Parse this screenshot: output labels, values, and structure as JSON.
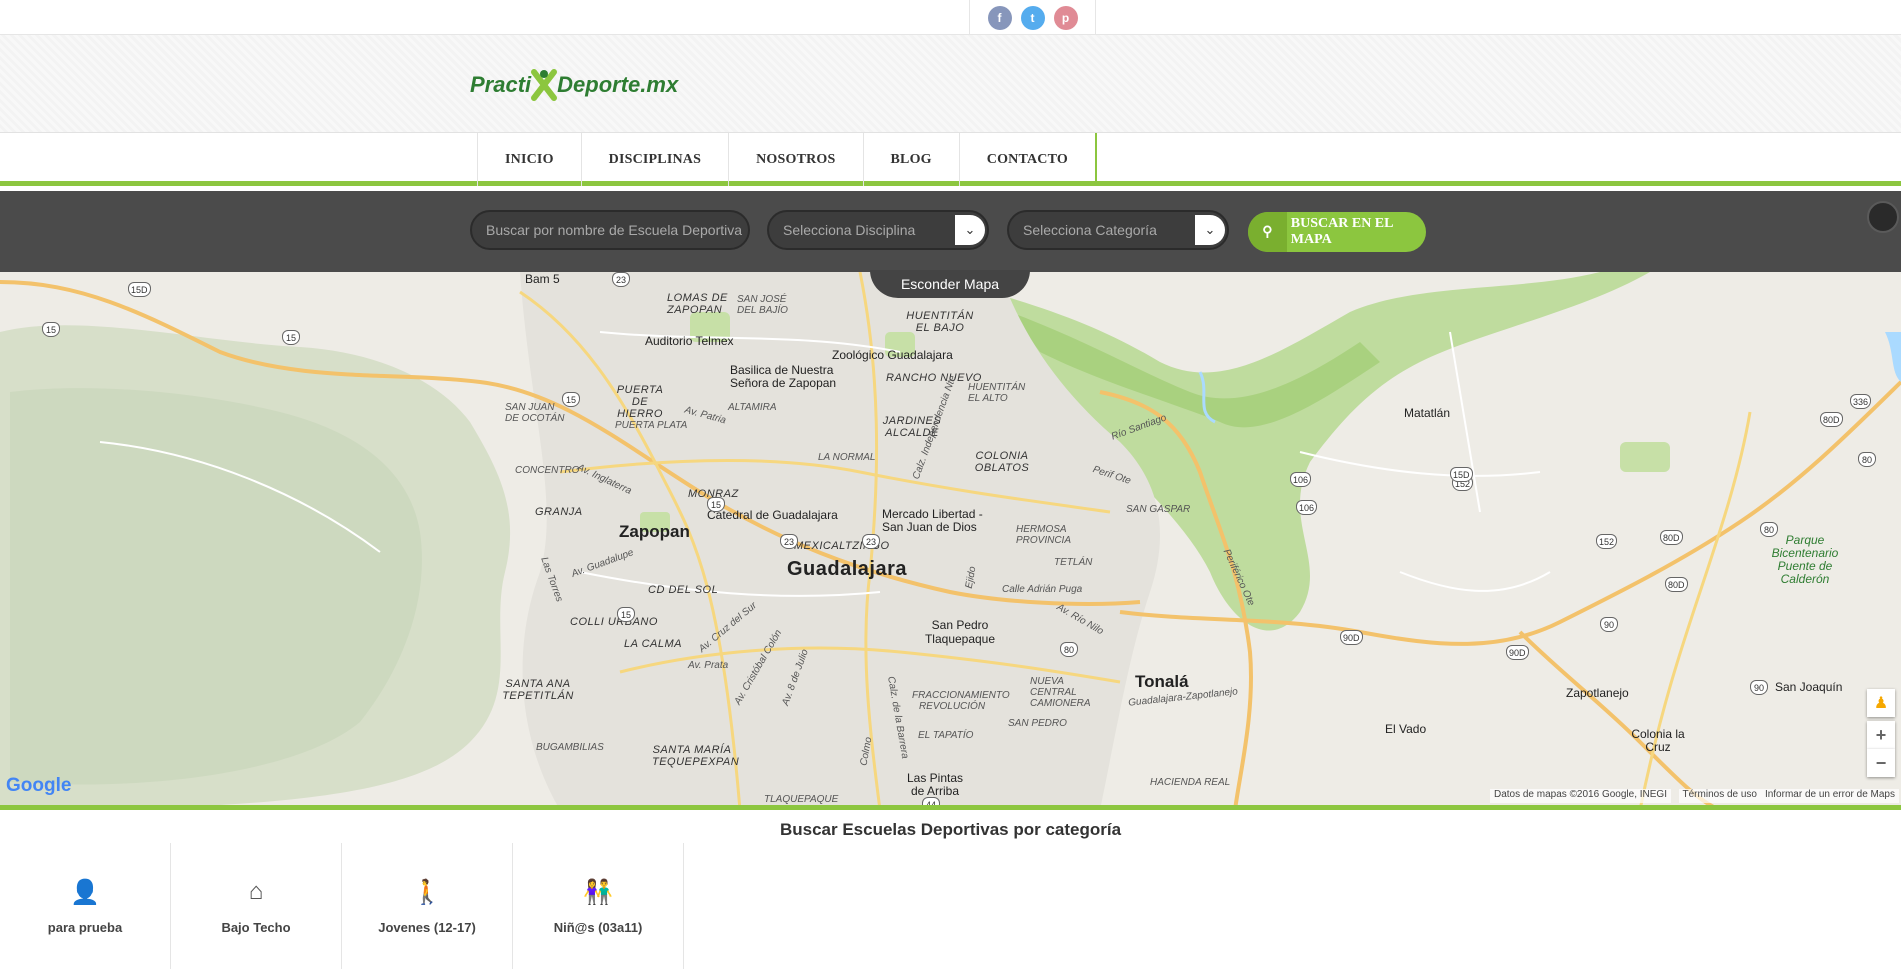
{
  "social": [
    {
      "name": "facebook",
      "glyph": "f",
      "color": "#8796bb"
    },
    {
      "name": "twitter",
      "glyph": "t",
      "color": "#55acee"
    },
    {
      "name": "pinterest",
      "glyph": "p",
      "color": "#e08b95"
    }
  ],
  "logo": {
    "part1": "Practi",
    "part2": "Deporte.mx"
  },
  "nav": [
    "INICIO",
    "DISCIPLINAS",
    "NOSOTROS",
    "BLOG",
    "CONTACTO"
  ],
  "search": {
    "name_placeholder": "Buscar por nombre de Escuela Deportiva",
    "discipline": "Selecciona Disciplina",
    "category": "Selecciona Categoría",
    "button": "BUSCAR EN EL MAPA",
    "toggle": "Esconder Mapa"
  },
  "map": {
    "labels": {
      "bam5": "Bam 5",
      "lomas": "LOMAS DE ZAPOPAN",
      "sanjose": "SAN JOSÉ DEL BAJÍO",
      "auditorio": "Auditorio Telmex",
      "huentitan_bajo": "HUENTITÁN EL BAJO",
      "zoologico": "Zoológico Guadalajara",
      "basilica": "Basilica de Nuestra Señora de Zapopan",
      "rancho": "RANCHO NUEVO",
      "huentitan_alto": "HUENTITÁN EL ALTO",
      "puerta": "PUERTA DE HIERRO",
      "altamira": "ALTAMIRA",
      "jardines": "JARDINES ALCALDE",
      "sanjuanocotan": "SAN JUAN DE OCOTÁN",
      "puertaplata": "PUERTA PLATA",
      "lanormal": "LA NORMAL",
      "oblatos": "COLONIA OBLATOS",
      "rio_santiago": "Río Santiago",
      "matatlan": "Matatlán",
      "concentro": "CONCENTRO",
      "monraz": "MONRAZ",
      "granja": "GRANJA",
      "zapopan": "Zapopan",
      "catedral": "Catedral de Guadalajara",
      "mercado": "Mercado Libertad - San Juan de Dios",
      "hermosa": "HERMOSA PROVINCIA",
      "sangaspar": "SAN GASPAR",
      "mexicaltzingo": "MEXICALTZINGO",
      "guadalajara": "Guadalajara",
      "tetlan": "TETLÁN",
      "cddelsol": "CD DEL SOL",
      "colliurbano": "COLLI URBANO",
      "sanpedro": "San Pedro Tlaquepaque",
      "lacalma": "LA CALMA",
      "tonala": "Tonalá",
      "santaana": "SANTA ANA TEPETITLÁN",
      "fraccionamiento": "FRACCIONAMIENTO REVOLUCIÓN",
      "nuevacentral": "NUEVA CENTRAL CAMIONERA",
      "santamaria": "SANTA MARÍA TEQUEPEXPAN",
      "eltapatio": "EL TAPATÍO",
      "sanpedroverde": "SAN PEDRO",
      "bugambilias": "BUGAMBILIAS",
      "pintas": "Las Pintas de Arriba",
      "hacienda": "HACIENDA REAL",
      "tlaquepaque": "TLAQUEPAQUE",
      "elvado": "El Vado",
      "zapotlanejo": "Zapotlanejo",
      "sanjoaquin": "San Joaquín",
      "coloniacruz": "Colonia la Cruz",
      "parque": "Parque Bicentenario Puente de Calderón",
      "perif": "Perif Ote",
      "periferico": "Periférico Ote",
      "gdl_zapotlanejo": "Guadalajara-Zapotlanejo",
      "av_patria": "Av. Patria",
      "av_inglaterra": "Av. Inglaterra",
      "av_guadalupe": "Av. Guadalupe",
      "av_cruz_sur": "Av. Cruz del Sur",
      "av_colon": "Av. Cristóbal Colón",
      "av_8julio": "Av. 8 de Julio",
      "calz_barrera": "Calz. de la Barrera",
      "av_rionilo": "Av. Río Nilo",
      "calle_pugas": "Calle Adrián Puga",
      "av_lostorres": "Las Torres",
      "av_prata": "Av. Prata",
      "av_colmo": "Colmo",
      "ejido": "Ejido",
      "av_indep": "Calz. Independencia Nte"
    },
    "shields": [
      "15D",
      "15",
      "15",
      "15",
      "23",
      "15",
      "23",
      "23",
      "15",
      "44",
      "80",
      "90D",
      "106",
      "106",
      "152",
      "152",
      "80D",
      "80",
      "80D",
      "336",
      "80",
      "90",
      "90",
      "90D",
      "15D",
      "80D"
    ],
    "attribution": "Datos de mapas ©2016 Google, INEGI",
    "terms": "Términos de uso",
    "report": "Informar de un error de Maps",
    "google": "Google"
  },
  "categories_title": "Buscar Escuelas Deportivas por categoría",
  "categories": [
    {
      "label": "para prueba",
      "icon": "user-icon",
      "glyph": "👤"
    },
    {
      "label": "Bajo Techo",
      "icon": "roof-icon",
      "glyph": "⌂"
    },
    {
      "label": "Jovenes (12-17)",
      "icon": "teens-icon",
      "glyph": "🚶"
    },
    {
      "label": "Niñ@s (03a11)",
      "icon": "kids-icon",
      "glyph": "👫"
    }
  ],
  "colors": {
    "accent": "#8cc63f",
    "dark_bar": "#444444"
  }
}
